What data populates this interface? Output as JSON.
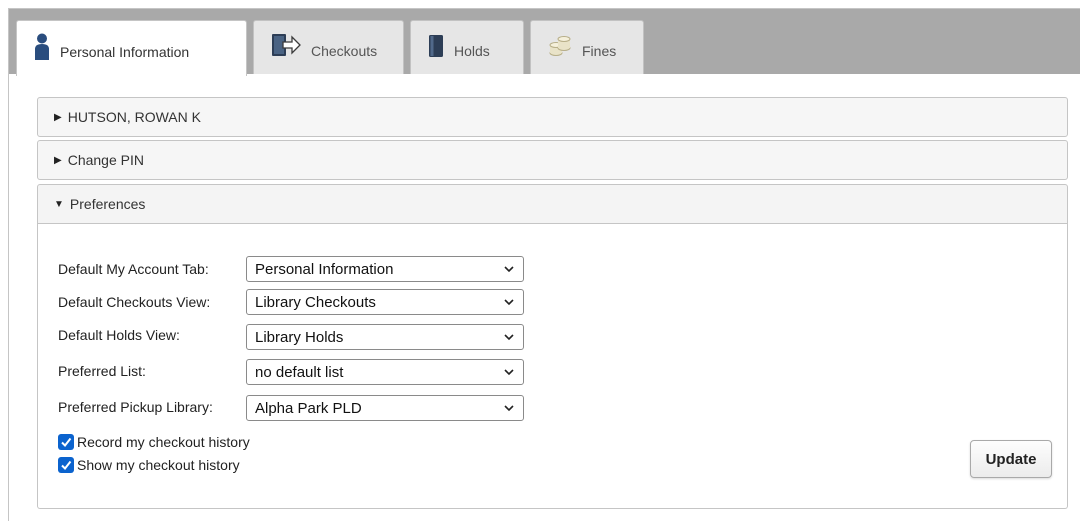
{
  "tabs": [
    {
      "label": "Personal Information",
      "icon": "person-icon",
      "active": true
    },
    {
      "label": "Checkouts",
      "icon": "checkout-book-icon",
      "active": false
    },
    {
      "label": "Holds",
      "icon": "book-icon",
      "active": false
    },
    {
      "label": "Fines",
      "icon": "coins-icon",
      "active": false
    }
  ],
  "sections": {
    "name": {
      "label": "HUTSON, ROWAN K",
      "state": "collapsed"
    },
    "pin": {
      "label": "Change PIN",
      "state": "collapsed"
    },
    "preferences": {
      "label": "Preferences",
      "state": "expanded"
    }
  },
  "preferences": {
    "fields": [
      {
        "label": "Default My Account Tab:",
        "value": "Personal Information"
      },
      {
        "label": "Default Checkouts View:",
        "value": "Library Checkouts"
      },
      {
        "label": "Default Holds View:",
        "value": "Library Holds"
      },
      {
        "label": "Preferred List:",
        "value": "no default list"
      },
      {
        "label": "Preferred Pickup Library:",
        "value": "Alpha Park PLD"
      }
    ],
    "checkboxes": [
      {
        "label": "Record my checkout history",
        "checked": true
      },
      {
        "label": "Show my checkout history",
        "checked": true
      }
    ],
    "update_label": "Update"
  },
  "colors": {
    "tabbar_bg": "#a9a9a9",
    "checkbox_accent": "#0b63ce",
    "person_icon": "#2a4d7e"
  }
}
